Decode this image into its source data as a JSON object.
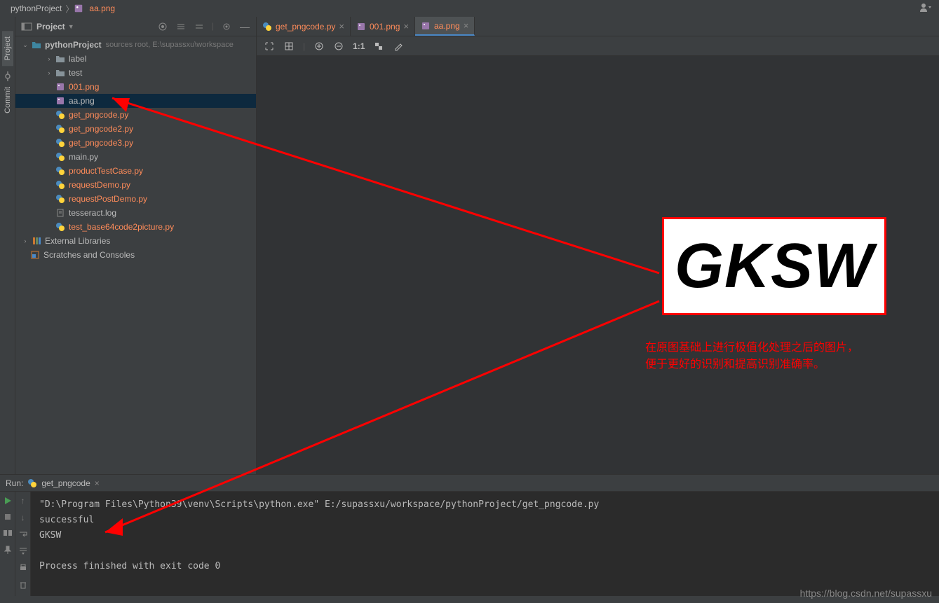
{
  "breadcrumb": {
    "project": "pythonProject",
    "file": "aa.png"
  },
  "sidebar": {
    "project_tab": "Project",
    "commit_tab": "Commit"
  },
  "project_panel": {
    "title": "Project",
    "root": "pythonProject",
    "root_hint": "sources root, E:\\supassxu\\workspace",
    "items": [
      {
        "label": "label",
        "type": "folder",
        "indent": 1
      },
      {
        "label": "test",
        "type": "folder",
        "indent": 1
      },
      {
        "label": "001.png",
        "type": "image",
        "indent": 1,
        "orange": true
      },
      {
        "label": "aa.png",
        "type": "image",
        "indent": 1,
        "selected": true
      },
      {
        "label": "get_pngcode.py",
        "type": "python",
        "indent": 1,
        "orange": true
      },
      {
        "label": "get_pngcode2.py",
        "type": "python",
        "indent": 1,
        "orange": true
      },
      {
        "label": "get_pngcode3.py",
        "type": "python",
        "indent": 1,
        "orange": true
      },
      {
        "label": "main.py",
        "type": "python",
        "indent": 1
      },
      {
        "label": "productTestCase.py",
        "type": "python",
        "indent": 1,
        "orange": true
      },
      {
        "label": "requestDemo.py",
        "type": "python",
        "indent": 1,
        "orange": true
      },
      {
        "label": "requestPostDemo.py",
        "type": "python",
        "indent": 1,
        "orange": true
      },
      {
        "label": "tesseract.log",
        "type": "text",
        "indent": 1
      },
      {
        "label": "test_base64code2picture.py",
        "type": "python",
        "indent": 1,
        "orange": true
      }
    ],
    "external": "External Libraries",
    "scratches": "Scratches and Consoles"
  },
  "tabs": [
    {
      "label": "get_pngcode.py",
      "type": "python",
      "orange": true
    },
    {
      "label": "001.png",
      "type": "image",
      "orange": true
    },
    {
      "label": "aa.png",
      "type": "image",
      "orange": true,
      "active": true
    }
  ],
  "image_toolbar": {
    "zoom_ratio": "1:1"
  },
  "run": {
    "label": "Run:",
    "config": "get_pngcode",
    "console_lines": [
      "\"D:\\Program Files\\Python39\\venv\\Scripts\\python.exe\" E:/supassxu/workspace/pythonProject/get_pngcode.py",
      "successful",
      "GKSW",
      "",
      "Process finished with exit code 0"
    ]
  },
  "overlay": {
    "image_text": "GKSW",
    "annotation_line1": "在原图基础上进行极值化处理之后的图片，",
    "annotation_line2": "便于更好的识别和提高识别准确率。"
  },
  "watermark": "https://blog.csdn.net/supassxu"
}
